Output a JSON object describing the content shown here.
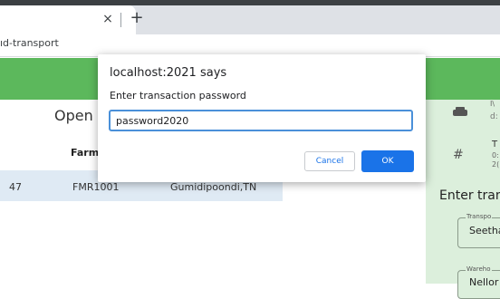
{
  "browser": {
    "tab_close": "×",
    "new_tab": "+",
    "url": "ıd-transport"
  },
  "page": {
    "title": "Open C",
    "column_header": "Farmer",
    "row": {
      "id_partial": "47",
      "farmer_id": "FMR1001",
      "location": "Gumidipoondi,TN"
    },
    "right_panel": {
      "item1_key": "I\\",
      "item1_value": "d:",
      "hash_symbol": "#",
      "item2_line1": "T",
      "item2_line2": "0:",
      "item2_line3": "2(",
      "enter_heading": "Enter tran",
      "field1_label": "Transpo",
      "field1_value": "Seetha",
      "field2_label": "Wareho",
      "field2_value": "Nellor"
    }
  },
  "dialog": {
    "title": "localhost:2021 says",
    "message": "Enter transaction password",
    "input_value": "password2020",
    "cancel_label": "Cancel",
    "ok_label": "OK"
  },
  "colors": {
    "header_green": "#5cb85c",
    "primary_blue": "#1a73e8",
    "row_highlight": "#dfeaf4",
    "panel_green": "#dcefdc"
  }
}
